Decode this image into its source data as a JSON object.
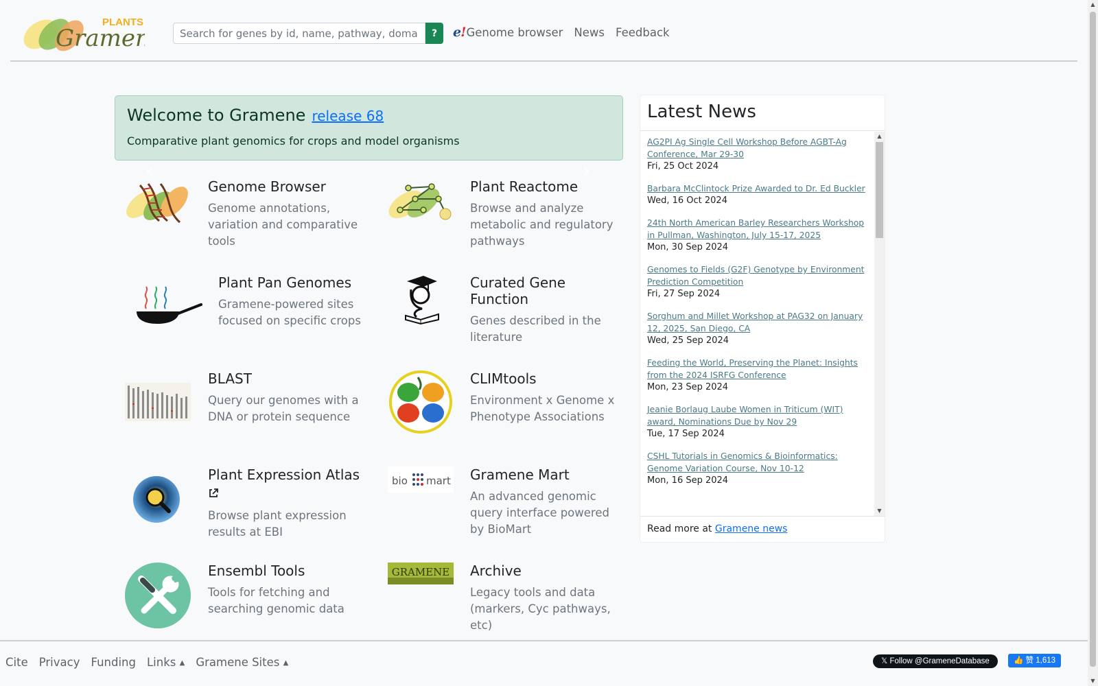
{
  "header": {
    "logo_alt": "Gramene PLANTS",
    "logo_small": "PLANTS",
    "logo_word": "Gramene",
    "search_placeholder": "Search for genes by id, name, pathway, domain, e",
    "search_help": "?",
    "nav": {
      "genome_browser_mark": "e",
      "genome_browser_bang": "!",
      "genome_browser": "Genome browser",
      "news": "News",
      "feedback": "Feedback"
    }
  },
  "welcome": {
    "title": "Welcome to Gramene",
    "release_link": "release 68",
    "subtitle": "Comparative plant genomics for crops and model organisms"
  },
  "tools": [
    {
      "title": "Genome Browser",
      "desc": "Genome annotations, variation and comparative tools",
      "icon": "dna-leaves-icon"
    },
    {
      "title": "Plant Reactome",
      "desc": "Browse and analyze metabolic and regulatory pathways",
      "icon": "pathway-network-icon"
    },
    {
      "title": "Plant Pan Genomes",
      "desc": "Gramene-powered sites focused on specific crops",
      "icon": "frying-pan-dna-icon"
    },
    {
      "title": "Curated Gene Function",
      "desc": "Genes described in the literature",
      "icon": "graduate-reading-icon"
    },
    {
      "title": "BLAST",
      "desc": "Query our genomes with a DNA or protein sequence",
      "icon": "chromosome-bars-icon"
    },
    {
      "title": "CLIMtools",
      "desc": "Environment x Genome x Phenotype Associations",
      "icon": "climate-clover-icon"
    },
    {
      "title": "Plant Expression Atlas",
      "desc": "Browse plant expression results at EBI",
      "icon": "magnifier-icon"
    },
    {
      "title": "Gramene Mart",
      "desc": "An advanced genomic query interface powered by BioMart",
      "icon": "biomart-icon",
      "logo_left": "bio",
      "logo_right": "mart"
    },
    {
      "title": "Ensembl Tools",
      "desc": "Tools for fetching and searching genomic data",
      "icon": "wrench-screwdriver-icon"
    },
    {
      "title": "Archive",
      "desc": "Legacy tools and data (markers, Cyc pathways, etc)",
      "icon": "gramene-archive-icon",
      "logo_text": "GRAMENE"
    }
  ],
  "news": {
    "title": "Latest News",
    "items": [
      {
        "title": "AG2PI Ag Single Cell Workshop Before AGBT-Ag Conference, Mar 29-30",
        "date": "Fri, 25 Oct 2024"
      },
      {
        "title": "Barbara McClintock Prize Awarded to Dr. Ed Buckler",
        "date": "Wed, 16 Oct 2024"
      },
      {
        "title": "24th North American Barley Researchers Workshop in Pullman, Washington, July 15-17, 2025",
        "date": "Mon, 30 Sep 2024"
      },
      {
        "title": "Genomes to Fields (G2F) Genotype by Environment Prediction Competition",
        "date": "Fri, 27 Sep 2024"
      },
      {
        "title": "Sorghum and Millet Workshop at PAG32 on January 12, 2025, San Diego, CA",
        "date": "Wed, 25 Sep 2024"
      },
      {
        "title": "Feeding the World, Preserving the Planet: Insights from the 2024 ISRFG Conference",
        "date": "Mon, 23 Sep 2024"
      },
      {
        "title": "Jeanie Borlaug Laube Women in Triticum (WIT) award, Nominations Due by Nov 29",
        "date": "Tue, 17 Sep 2024"
      },
      {
        "title": "CSHL Tutorials in Genomics & Bioinformatics: Genome Variation Course, Nov 10-12",
        "date": "Mon, 16 Sep 2024"
      }
    ],
    "read_more_prefix": "Read more at",
    "read_more_link": "Gramene news"
  },
  "footer": {
    "links": [
      "Cite",
      "Privacy",
      "Funding"
    ],
    "dropdowns": [
      "Links",
      "Gramene Sites"
    ],
    "twitter": "Follow @GrameneDatabase",
    "facebook_label": "赞",
    "facebook_count": "1,613"
  },
  "colors": {
    "accent_green": "#198754",
    "welcome_bg": "#d1e7dd",
    "link_blue": "#0d6efd",
    "news_link": "#4a7a88"
  }
}
